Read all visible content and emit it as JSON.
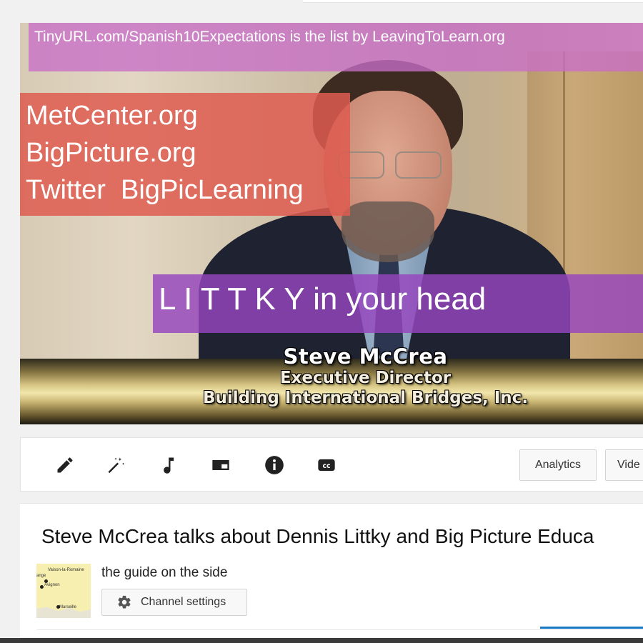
{
  "video": {
    "overlay_top": "TinyURL.com/Spanish10Expectations is the list by LeavingToLearn.org",
    "overlay_links": [
      "MetCenter.org",
      "BigPicture.org",
      "Twitter  BigPicLearning"
    ],
    "overlay_littky": "L I T T K Y in your head",
    "lower_third": {
      "name": "Steve McCrea",
      "title": "Executive Director",
      "org": "Building International Bridges, Inc."
    }
  },
  "toolbar": {
    "tools": [
      {
        "icon": "pencil-icon"
      },
      {
        "icon": "magic-wand-icon"
      },
      {
        "icon": "music-note-icon"
      },
      {
        "icon": "end-screen-icon"
      },
      {
        "icon": "info-icon"
      },
      {
        "icon": "cc-icon",
        "label": "cc"
      }
    ],
    "analytics_label": "Analytics",
    "video_manager_label": "Vide"
  },
  "info": {
    "video_title": "Steve McCrea talks about Dennis Littky and Big Picture Educa",
    "channel_name": "the guide on the side",
    "channel_settings_label": "Channel settings",
    "avatar_map_labels": [
      "Vaison-la-Romaine",
      "Avignon",
      "Marseille",
      "ange"
    ]
  },
  "colors": {
    "overlay_purple": "#c86ec8",
    "overlay_red": "#de5c50",
    "overlay_violet": "#9646be",
    "accent_blue": "#167ac6"
  }
}
